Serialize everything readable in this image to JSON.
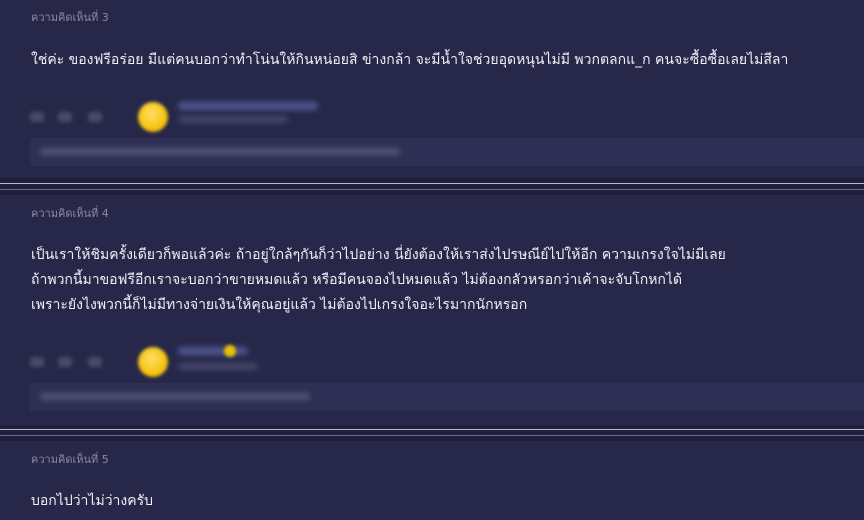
{
  "comments": [
    {
      "label": "ความคิดเห็นที่ 3",
      "lines": [
        "ใช่ค่ะ ของฟรีอร่อย มีแต่คนบอกว่าทำโน่นให้กินหน่อยสิ ข่างกล้า จะมีน้ำใจช่วยอุดหนุนไม่มี พวกตลกแ_ก คนจะซื้อซื้อเลยไม่สีลา"
      ]
    },
    {
      "label": "ความคิดเห็นที่ 4",
      "lines": [
        "เป็นเราให้ชิมครั้งเดียวก็พอแล้วค่ะ ถ้าอยู่ใกล้ๆกันก็ว่าไปอย่าง นี่ยังต้องให้เราส่งไปรษณีย์ไปให้อีก ความเกรงใจไม่มีเลย",
        "ถ้าพวกนี้มาขอฟรีอีกเราจะบอกว่าขายหมดแล้ว หรือมีคนจองไปหมดแล้ว ไม่ต้องกลัวหรอกว่าเค้าจะจับโกหกได้",
        "เพราะยังไงพวกนี้ก็ไม่มีทางจ่ายเงินให้คุณอยู่แล้ว ไม่ต้องไปเกรงใจอะไรมากนักหรอก"
      ]
    },
    {
      "label": "ความคิดเห็นที่ 5",
      "lines": [
        "บอกไปว่าไม่ว่างครับ"
      ]
    }
  ]
}
